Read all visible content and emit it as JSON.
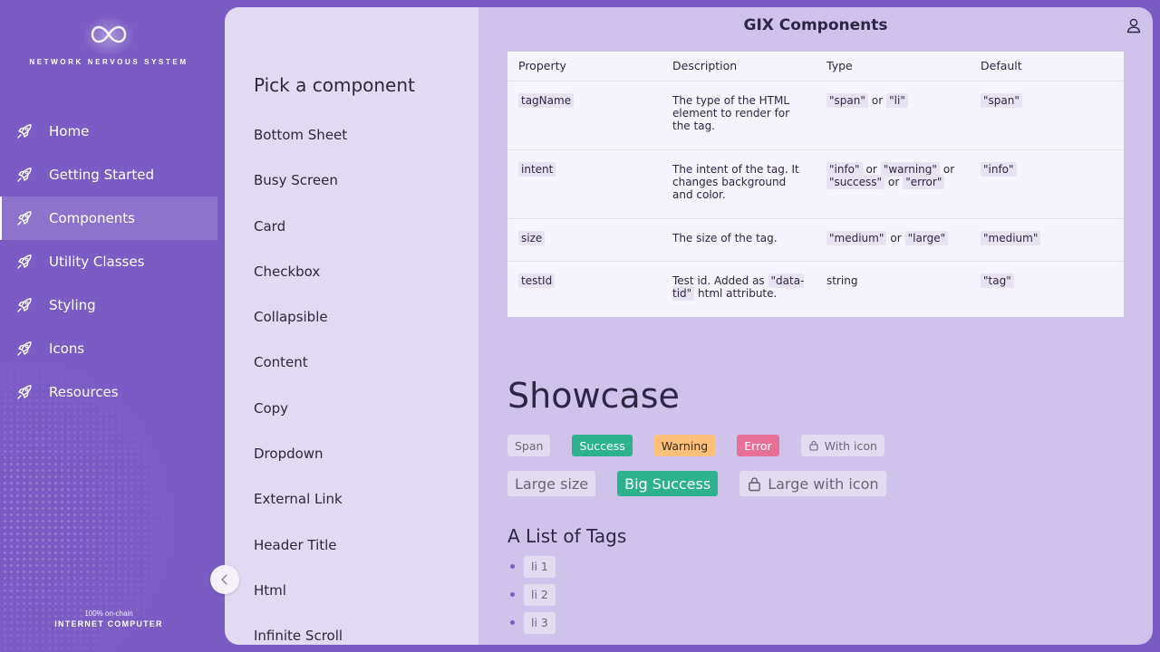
{
  "nav": {
    "logo_text": "NETWORK NERVOUS SYSTEM",
    "items": [
      {
        "label": "Home",
        "active": false
      },
      {
        "label": "Getting Started",
        "active": false
      },
      {
        "label": "Components",
        "active": true
      },
      {
        "label": "Utility Classes",
        "active": false
      },
      {
        "label": "Styling",
        "active": false
      },
      {
        "label": "Icons",
        "active": false
      },
      {
        "label": "Resources",
        "active": false
      }
    ],
    "footer_small": "100% on-chain",
    "footer_big": "INTERNET COMPUTER"
  },
  "picker": {
    "title": "Pick a component",
    "items": [
      "Bottom Sheet",
      "Busy Screen",
      "Card",
      "Checkbox",
      "Collapsible",
      "Content",
      "Copy",
      "Dropdown",
      "External Link",
      "Header Title",
      "Html",
      "Infinite Scroll"
    ]
  },
  "header": {
    "title": "GIX Components"
  },
  "table": {
    "headers": [
      "Property",
      "Description",
      "Type",
      "Default"
    ],
    "rows": [
      {
        "prop": "tagName",
        "desc": "The type of the HTML element to render for the tag.",
        "type_a": "\"span\"",
        "type_or": "or",
        "type_b": "\"li\"",
        "default": "\"span\""
      },
      {
        "prop": "intent",
        "desc": "The intent of the tag. It changes background and color.",
        "type_a": "\"info\"",
        "type_or1": "or",
        "type_b": "\"warning\"",
        "type_or2": "or",
        "type_c": "\"success\"",
        "type_or3": "or",
        "type_d": "\"error\"",
        "default": "\"info\""
      },
      {
        "prop": "size",
        "desc": "The size of the tag.",
        "type_a": "\"medium\"",
        "type_or": "or",
        "type_b": "\"large\"",
        "default": "\"medium\""
      },
      {
        "prop": "testId",
        "desc_pre": "Test id. Added as",
        "desc_code": "\"data-tid\"",
        "desc_post": "html attribute.",
        "type": "string",
        "default": "\"tag\""
      }
    ]
  },
  "showcase": {
    "title": "Showcase",
    "row1": [
      "Span",
      "Success",
      "Warning",
      "Error",
      "With icon"
    ],
    "row2": [
      "Large size",
      "Big Success",
      "Large with icon"
    ],
    "list_title": "A List of Tags",
    "list": [
      "li 1",
      "li 2",
      "li 3"
    ]
  },
  "colors": {
    "brand": "#7b5cc4",
    "success": "#2cb38e",
    "warning": "#fcc07a",
    "error": "#e76f98"
  },
  "icons": [
    "infinity-logo-icon",
    "rocket-icon",
    "user-icon",
    "chevron-left-icon",
    "lock-icon"
  ]
}
